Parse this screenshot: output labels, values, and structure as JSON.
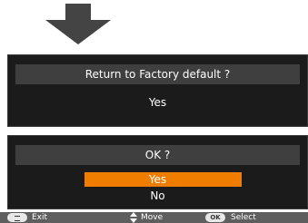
{
  "colors": {
    "background": "#ffffff",
    "panel": "#1b1b1b",
    "title_bar": "#3f3f3f",
    "highlight": "#f07d00",
    "footer": "#5e5e5e",
    "text": "#ffffff",
    "arrow": "#444444"
  },
  "icons": {
    "down_arrow": "down-arrow-icon",
    "menu_button": "menu-button-icon",
    "move": "up-down-arrow-icon",
    "ok_button": "ok-button-icon"
  },
  "dialog_factory": {
    "title": "Return to Factory default ?",
    "option": "Yes"
  },
  "dialog_confirm": {
    "title": "OK ?",
    "options": [
      "Yes",
      "No"
    ],
    "selected": "Yes"
  },
  "footer": {
    "exit_label": "Exit",
    "move_label": "Move",
    "ok_key": "OK",
    "select_label": "Select"
  }
}
